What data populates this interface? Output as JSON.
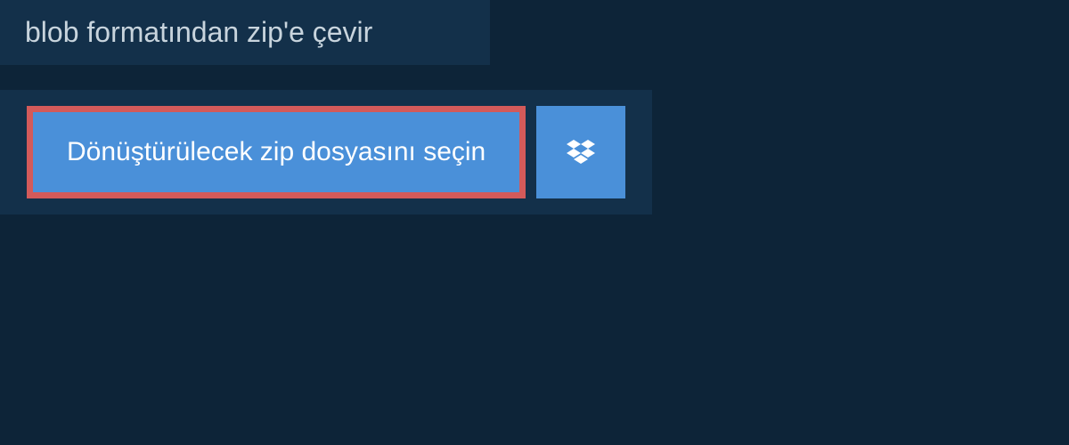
{
  "header": {
    "title": "blob formatından zip'e çevir"
  },
  "actions": {
    "select_file_label": "Dönüştürülecek zip dosyasını seçin"
  },
  "colors": {
    "page_bg": "#0d2438",
    "panel_bg": "#13304a",
    "button_bg": "#4a90d9",
    "button_border": "#d35a5a",
    "text_light": "#c8d4dd",
    "text_white": "#ffffff"
  }
}
